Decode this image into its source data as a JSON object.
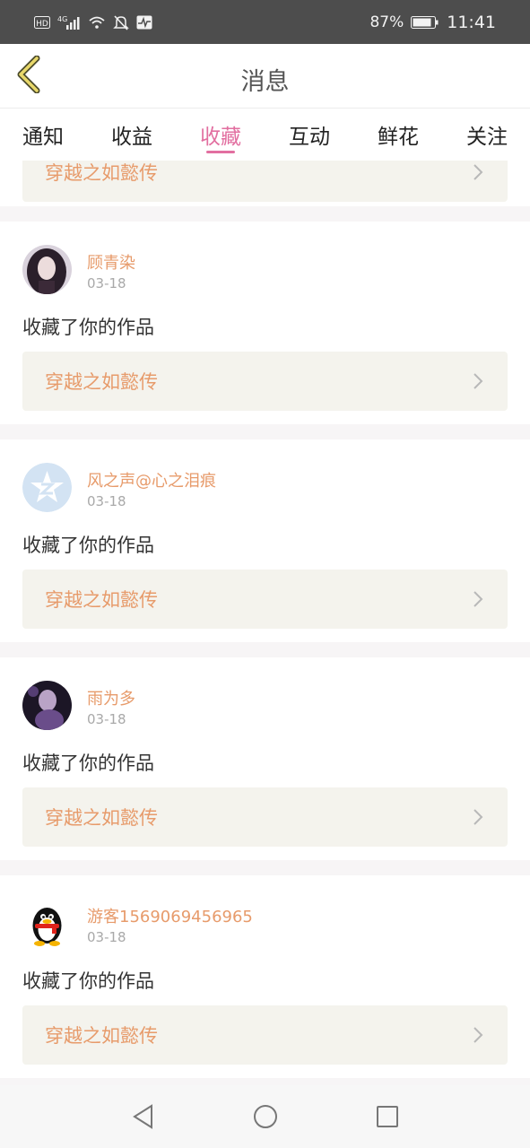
{
  "status_bar": {
    "left_icons": [
      "hd-icon",
      "4g-signal-icon",
      "wifi-icon",
      "mute-icon",
      "activity-icon"
    ],
    "battery": "87%",
    "time": "11:41"
  },
  "header": {
    "title": "消息",
    "back_icon": "chevron-left-icon"
  },
  "tabs": [
    {
      "label": "通知",
      "active": false
    },
    {
      "label": "收益",
      "active": false
    },
    {
      "label": "收藏",
      "active": true
    },
    {
      "label": "互动",
      "active": false
    },
    {
      "label": "鲜花",
      "active": false
    },
    {
      "label": "关注",
      "active": false
    }
  ],
  "partial_item": {
    "work_title": "穿越之如懿传"
  },
  "items": [
    {
      "username": "顾青染",
      "date": "03-18",
      "action": "收藏了你的作品",
      "work_title": "穿越之如懿传",
      "avatar": "portrait-dark"
    },
    {
      "username": "风之声@心之泪痕",
      "date": "03-18",
      "action": "收藏了你的作品",
      "work_title": "穿越之如懿传",
      "avatar": "qzone-logo"
    },
    {
      "username": "雨为多",
      "date": "03-18",
      "action": "收藏了你的作品",
      "work_title": "穿越之如懿传",
      "avatar": "portrait-purple"
    },
    {
      "username": "游客1569069456965",
      "date": "03-18",
      "action": "收藏了你的作品",
      "work_title": "穿越之如懿传",
      "avatar": "qq-penguin"
    }
  ],
  "colors": {
    "accent": "#e26fa0",
    "username": "#e79b6b",
    "link_bg": "#f4f3ed",
    "status_bar": "#4d4d4d"
  },
  "nav_bar": {
    "icons": [
      "back-triangle-icon",
      "home-circle-icon",
      "recents-square-icon"
    ]
  }
}
